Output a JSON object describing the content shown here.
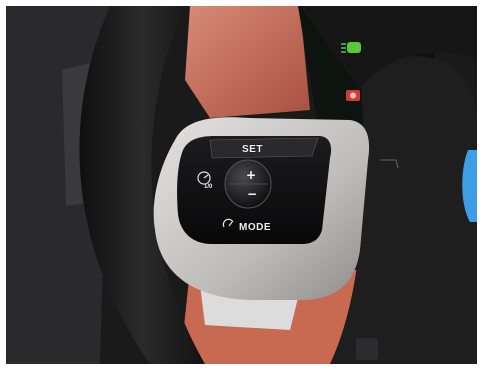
{
  "controls": {
    "set_label": "SET",
    "mode_label": "MODE",
    "resume_label": "1/0",
    "plus_glyph": "+",
    "minus_glyph": "−"
  },
  "icons": {
    "headlight_indicator": "headlight-icon",
    "warning_indicator": "warning-icon",
    "speed_limiter": "speedometer-icon",
    "mode_dial": "gauge-icon"
  },
  "colors": {
    "steering_wheel": "#1f1f20",
    "silver_trim": "#c9c9c8",
    "cabin_red": "#c76a58",
    "indicator_green": "#58c83a",
    "indicator_red": "#d63b33",
    "accent_blue": "#3d9ee6"
  }
}
